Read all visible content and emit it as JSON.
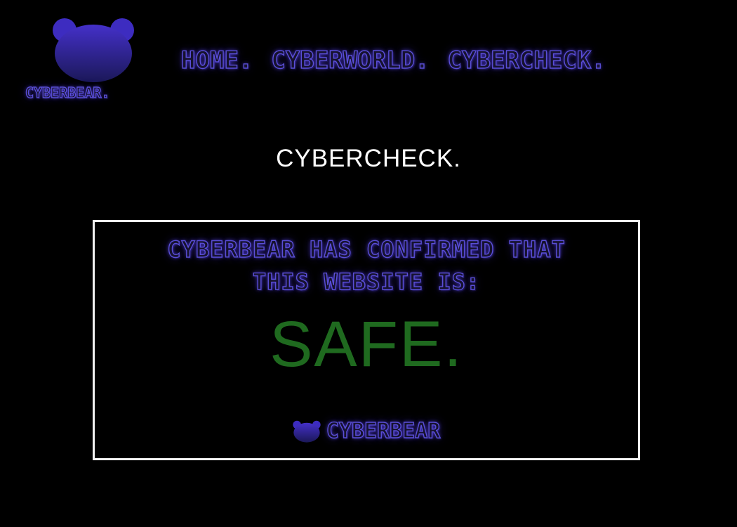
{
  "brand": {
    "logo_text": "CYBERBEAR.",
    "logo_icon": "bear-head-icon",
    "colors": {
      "bear_gradient_top": "#3f2dbf",
      "bear_gradient_bottom": "#1e1a62",
      "glow_purple": "#5a4fd6",
      "safe_green": "#1f6a1f",
      "background": "#000000",
      "panel_border": "#f2f2f2"
    }
  },
  "nav": {
    "items": [
      {
        "label": "HOME."
      },
      {
        "label": "CYBERWORLD."
      },
      {
        "label": "CYBERCHECK."
      }
    ]
  },
  "page": {
    "title": "CYBERCHECK."
  },
  "result": {
    "message_line1": "CYBERBEAR HAS CONFIRMED THAT",
    "message_line2": "THIS WEBSITE IS:",
    "status": "SAFE.",
    "footer_label": "CYBERBEAR",
    "footer_icon": "bear-head-icon"
  }
}
